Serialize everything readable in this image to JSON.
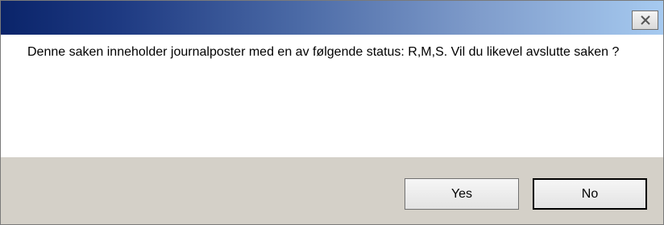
{
  "titlebar": {
    "close_icon": "close-icon"
  },
  "message": {
    "text": "Denne saken inneholder journalposter med en av følgende status: R,M,S. Vil du likevel avslutte saken ?"
  },
  "buttons": {
    "yes_label": "Yes",
    "no_label": "No"
  },
  "colors": {
    "titlebar_start": "#0a246a",
    "titlebar_end": "#a6caf0",
    "footer_bg": "#d4d0c8"
  }
}
